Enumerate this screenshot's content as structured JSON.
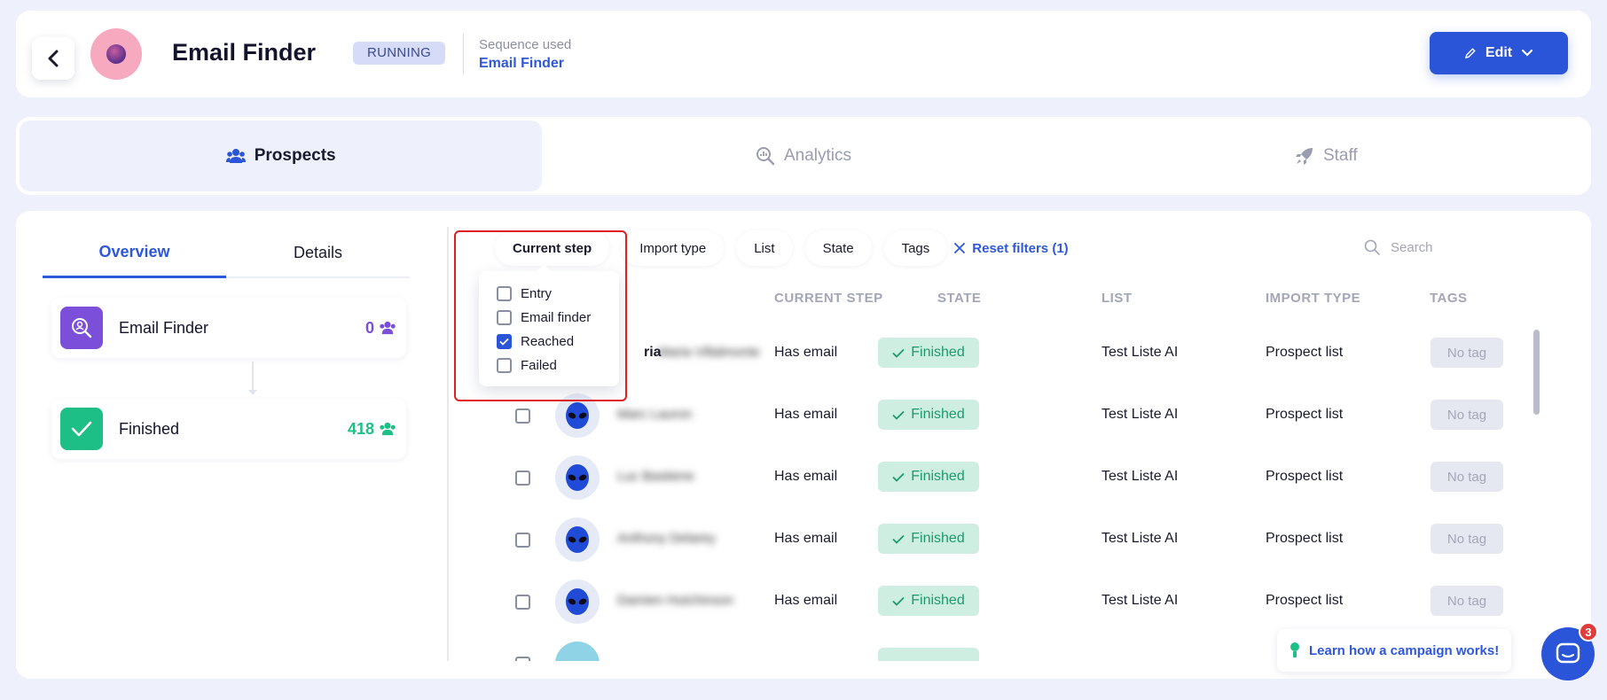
{
  "header": {
    "title": "Email Finder",
    "status": "RUNNING",
    "sequence_label": "Sequence used",
    "sequence_name": "Email Finder",
    "edit_label": "Edit"
  },
  "tabs": [
    {
      "label": "Prospects",
      "icon": "users-icon",
      "active": true
    },
    {
      "label": "Analytics",
      "icon": "analytics-icon",
      "active": false
    },
    {
      "label": "Staff",
      "icon": "rocket-icon",
      "active": false
    }
  ],
  "left_panel": {
    "subtabs": [
      "Overview",
      "Details"
    ],
    "steps": [
      {
        "name": "Email Finder",
        "count": "0",
        "color": "#7b4fd9"
      },
      {
        "name": "Finished",
        "count": "418",
        "color": "#1dbf86"
      }
    ]
  },
  "filters": {
    "chips": [
      "Current step",
      "Import type",
      "List",
      "State",
      "Tags"
    ],
    "reset_label": "Reset filters (1)",
    "search_placeholder": "Search"
  },
  "dropdown": {
    "options": [
      {
        "label": "Entry",
        "checked": false
      },
      {
        "label": "Email finder",
        "checked": false
      },
      {
        "label": "Reached",
        "checked": true
      },
      {
        "label": "Failed",
        "checked": false
      }
    ]
  },
  "table": {
    "columns": [
      "CURRENT STEP",
      "STATE",
      "LIST",
      "IMPORT TYPE",
      "TAGS"
    ],
    "visible_name_fragment": "ria",
    "rows": [
      {
        "name": "Maria Villalmonte",
        "step": "Has email",
        "state": "Finished",
        "list": "Test Liste AI",
        "import_type": "Prospect list",
        "tags": "No tag"
      },
      {
        "name": "Marc Lauron",
        "step": "Has email",
        "state": "Finished",
        "list": "Test Liste AI",
        "import_type": "Prospect list",
        "tags": "No tag"
      },
      {
        "name": "Luc Bastiene",
        "step": "Has email",
        "state": "Finished",
        "list": "Test Liste AI",
        "import_type": "Prospect list",
        "tags": "No tag"
      },
      {
        "name": "Anthony Delarey",
        "step": "Has email",
        "state": "Finished",
        "list": "Test Liste AI",
        "import_type": "Prospect list",
        "tags": "No tag"
      },
      {
        "name": "Damien Hutchinson",
        "step": "Has email",
        "state": "Finished",
        "list": "Test Liste AI",
        "import_type": "Prospect list",
        "tags": "No tag"
      }
    ]
  },
  "help": {
    "label": "Learn how a campaign works!"
  },
  "chat": {
    "badge": "3"
  }
}
